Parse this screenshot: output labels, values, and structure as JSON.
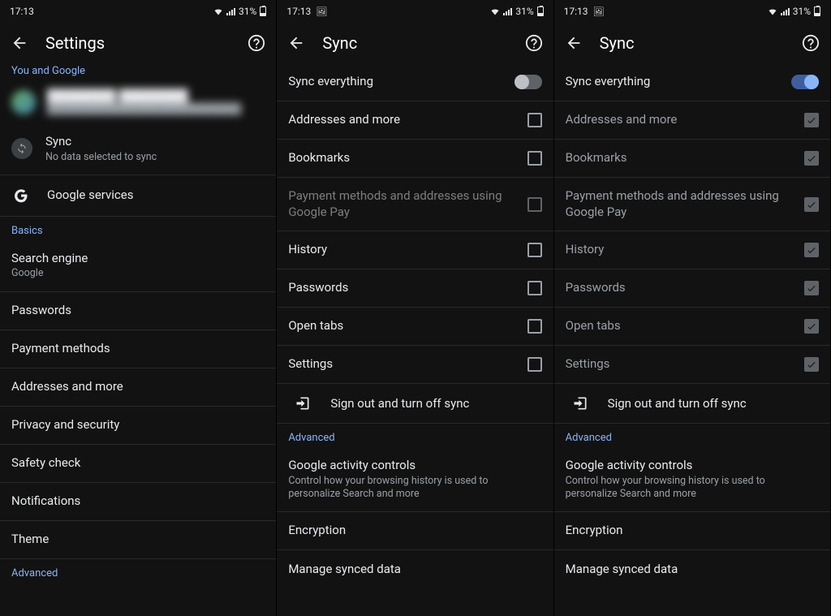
{
  "status": {
    "time": "17:13",
    "batt_pct": "31%",
    "notif_glyph": "🖼"
  },
  "panel1": {
    "title": "Settings",
    "sections": {
      "you_and_google": "You and Google",
      "basics": "Basics",
      "advanced": "Advanced"
    },
    "account": {
      "name_masked": "████████ ████████",
      "email_masked": "███████████████████████████"
    },
    "sync": {
      "title": "Sync",
      "subtitle": "No data selected to sync"
    },
    "google_services": "Google services",
    "search_engine": {
      "title": "Search engine",
      "value": "Google"
    },
    "items": {
      "passwords": "Passwords",
      "payment_methods": "Payment methods",
      "addresses": "Addresses and more",
      "privacy": "Privacy and security",
      "safety": "Safety check",
      "notifications": "Notifications",
      "theme": "Theme"
    }
  },
  "sync_common": {
    "title": "Sync",
    "sync_everything": "Sync everything",
    "items": {
      "addresses": "Addresses and more",
      "bookmarks": "Bookmarks",
      "payment_gpay": "Payment methods and addresses using Google Pay",
      "history": "History",
      "passwords": "Passwords",
      "open_tabs": "Open tabs",
      "settings": "Settings"
    },
    "sign_out": "Sign out and turn off sync",
    "advanced": "Advanced",
    "google_activity": {
      "title": "Google activity controls",
      "sub": "Control how your browsing history is used to personalize Search and more"
    },
    "encryption": "Encryption",
    "manage_synced": "Manage synced data"
  },
  "panel2": {
    "sync_everything_on": false,
    "items_state": {
      "payment_gpay_enabled": false
    }
  },
  "panel3": {
    "sync_everything_on": true
  }
}
